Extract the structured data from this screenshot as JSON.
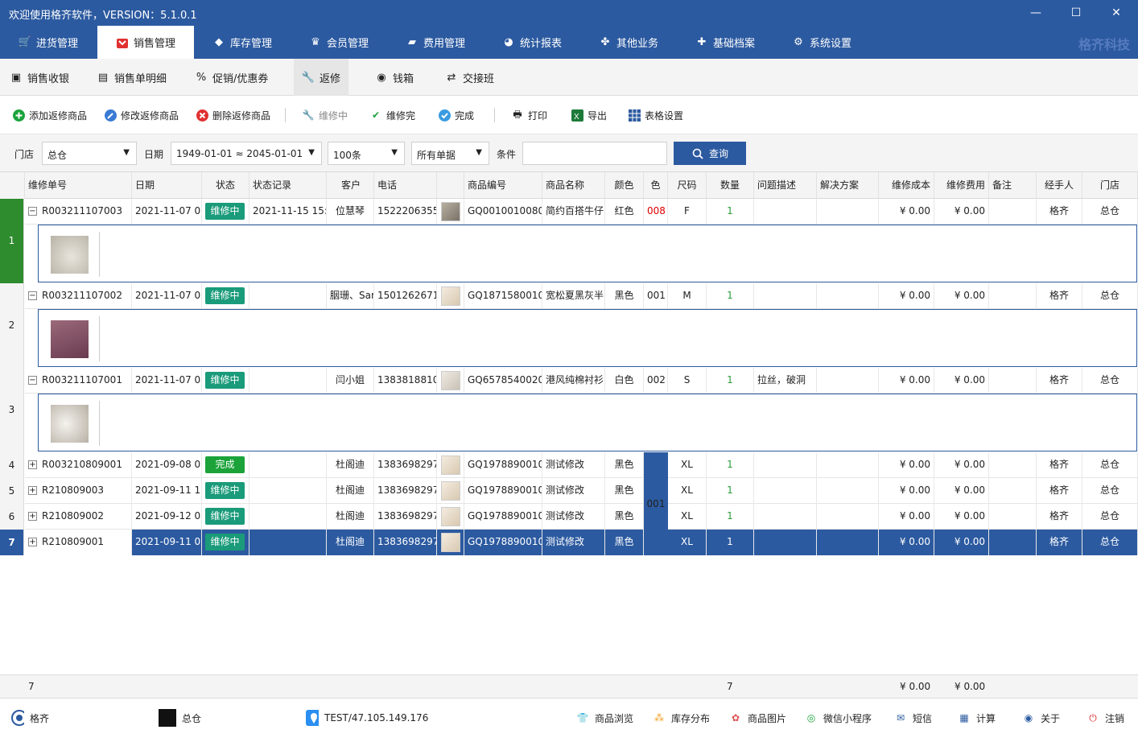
{
  "window": {
    "title": "欢迎使用格齐软件，VERSION：5.1.0.1"
  },
  "brand": "格齐科技",
  "top_tabs": [
    "进货管理",
    "销售管理",
    "库存管理",
    "会员管理",
    "费用管理",
    "统计报表",
    "其他业务",
    "基础档案",
    "系统设置"
  ],
  "sub_tabs": [
    "销售收银",
    "销售单明细",
    "促销/优惠券",
    "返修",
    "钱箱",
    "交接班"
  ],
  "toolbar": {
    "add": "添加返修商品",
    "edit": "修改返修商品",
    "del": "删除返修商品",
    "repairing": "维修中",
    "repaired": "维修完",
    "done": "完成",
    "print": "打印",
    "export": "导出",
    "table": "表格设置"
  },
  "filter": {
    "store_label": "门店",
    "store": "总仓",
    "date_label": "日期",
    "date": "1949-01-01 ≈ 2045-01-01",
    "count": "100条",
    "scope": "所有单据",
    "cond_label": "条件",
    "cond_value": "",
    "query": "查询"
  },
  "columns": [
    "维修单号",
    "日期",
    "状态",
    "状态记录",
    "客户",
    "电话",
    "",
    "商品编号",
    "商品名称",
    "颜色",
    "色",
    "尺码",
    "数量",
    "问题描述",
    "解决方案",
    "维修成本",
    "维修费用",
    "备注",
    "经手人",
    "门店"
  ],
  "rows": [
    {
      "no": "1",
      "id": "R003211107003",
      "date": "2021-11-07 0",
      "status": "维修中",
      "record": "2021-11-15 15:",
      "customer": "位慧琴",
      "phone": "1522206355",
      "code": "GQ0010010080",
      "name": "简约百搭牛仔",
      "color": "红色",
      "ccode": "008",
      "size": "F",
      "qty": "1",
      "problem": "",
      "cost": "¥ 0.00",
      "fee": "¥ 0.00",
      "handler": "格齐",
      "store": "总仓"
    },
    {
      "no": "2",
      "id": "R003211107002",
      "date": "2021-11-07 0",
      "status": "维修中",
      "record": "",
      "customer": "胭珊、Sar",
      "phone": "1501262671",
      "code": "GQ1871580010",
      "name": "宽松夏黑灰半",
      "color": "黑色",
      "ccode": "001",
      "size": "M",
      "qty": "1",
      "problem": "",
      "cost": "¥ 0.00",
      "fee": "¥ 0.00",
      "handler": "格齐",
      "store": "总仓"
    },
    {
      "no": "3",
      "id": "R003211107001",
      "date": "2021-11-07 0",
      "status": "维修中",
      "record": "",
      "customer": "闫小姐",
      "phone": "1383818810",
      "code": "GQ6578540020",
      "name": "港风纯棉衬衫",
      "color": "白色",
      "ccode": "002",
      "size": "S",
      "qty": "1",
      "problem": "拉丝，破洞",
      "cost": "¥ 0.00",
      "fee": "¥ 0.00",
      "handler": "格齐",
      "store": "总仓"
    },
    {
      "no": "4",
      "id": "R003210809001",
      "date": "2021-09-08 0",
      "status": "完成",
      "record": "",
      "customer": "杜阁迪",
      "phone": "1383698297",
      "code": "GQ1978890010",
      "name": "测试修改",
      "color": "黑色",
      "ccode": "",
      "size": "XL",
      "qty": "1",
      "problem": "",
      "cost": "¥ 0.00",
      "fee": "¥ 0.00",
      "handler": "格齐",
      "store": "总仓"
    },
    {
      "no": "5",
      "id": "R210809003",
      "date": "2021-09-11 1",
      "status": "维修中",
      "record": "",
      "customer": "杜阁迪",
      "phone": "1383698297",
      "code": "GQ1978890010",
      "name": "测试修改",
      "color": "黑色",
      "ccode": "",
      "size": "XL",
      "qty": "1",
      "problem": "",
      "cost": "¥ 0.00",
      "fee": "¥ 0.00",
      "handler": "格齐",
      "store": "总仓"
    },
    {
      "no": "6",
      "id": "R210809002",
      "date": "2021-09-12 0",
      "status": "维修中",
      "record": "",
      "customer": "杜阁迪",
      "phone": "1383698297",
      "code": "GQ1978890010",
      "name": "测试修改",
      "color": "黑色",
      "ccode": "",
      "size": "XL",
      "qty": "1",
      "problem": "",
      "cost": "¥ 0.00",
      "fee": "¥ 0.00",
      "handler": "格齐",
      "store": "总仓"
    },
    {
      "no": "7",
      "id": "R210809001",
      "date": "2021-09-11 0",
      "status": "维修中",
      "record": "",
      "customer": "杜阁迪",
      "phone": "1383698297",
      "code": "GQ1978890010",
      "name": "测试修改",
      "color": "黑色",
      "ccode": "",
      "size": "XL",
      "qty": "1",
      "problem": "",
      "cost": "¥ 0.00",
      "fee": "¥ 0.00",
      "handler": "格齐",
      "store": "总仓"
    }
  ],
  "merged_ccode": "001",
  "summary": {
    "count": "7",
    "qty": "7",
    "cost": "¥ 0.00",
    "fee": "¥ 0.00"
  },
  "statusbar": {
    "user": "格齐",
    "store": "总仓",
    "server": "TEST/47.105.149.176",
    "browse": "商品浏览",
    "stock": "库存分布",
    "images": "商品图片",
    "wechat": "微信小程序",
    "sms": "短信",
    "calc": "计算",
    "about": "关于",
    "logout": "注销"
  },
  "colors": {
    "primary": "#2c5aa0",
    "repairing": "#1a9b7a",
    "done": "#1ba33a",
    "selected_row": "#2c5aa0",
    "row_marker": "#2e8b2e"
  }
}
